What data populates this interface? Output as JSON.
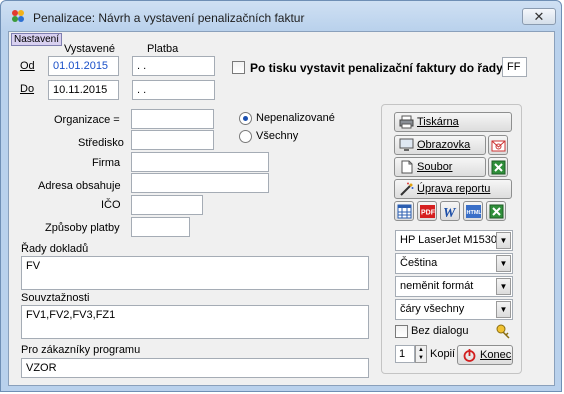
{
  "window": {
    "title": "Penalizace: Návrh a vystavení penalizačních faktur",
    "close_glyph": "✕"
  },
  "tag": "Nastavení",
  "dates": {
    "col_issued": "Vystavené",
    "col_payment": "Platba",
    "from_label": "Od",
    "to_label": "Do",
    "from_issued": "01.01.2015",
    "from_payment": " . .",
    "to_issued": "10.11.2015",
    "to_payment": " . ."
  },
  "print_series": {
    "label": "Po tisku vystavit penalizační faktury do řady",
    "value": "FF"
  },
  "filters": {
    "organization_label": "Organizace =",
    "center_label": "Středisko",
    "company_label": "Firma",
    "address_label": "Adresa obsahuje",
    "ico_label": "IČO",
    "payment_methods_label": "Způsoby platby"
  },
  "radios": {
    "unpenalized": "Nepenalizované",
    "all": "Všechny"
  },
  "document_series": {
    "label": "Řady dokladů",
    "value": "FV"
  },
  "related": {
    "label": "Souvztažnosti",
    "value": "FV1,FV2,FV3,FZ1"
  },
  "customers": {
    "label": "Pro zákazníky programu",
    "value": "VZOR"
  },
  "actions": {
    "printer": "Tiskárna",
    "screen": "Obrazovka",
    "file": "Soubor",
    "edit_report": "Úprava reportu"
  },
  "options": {
    "printer_select": "HP LaserJet M1530",
    "language_select": "Čeština",
    "format_select": "neměnit formát",
    "lines_select": "čáry všechny",
    "no_dialog": "Bez dialogu",
    "copies": "1",
    "copies_label": "Kopií",
    "end": "Konec"
  }
}
